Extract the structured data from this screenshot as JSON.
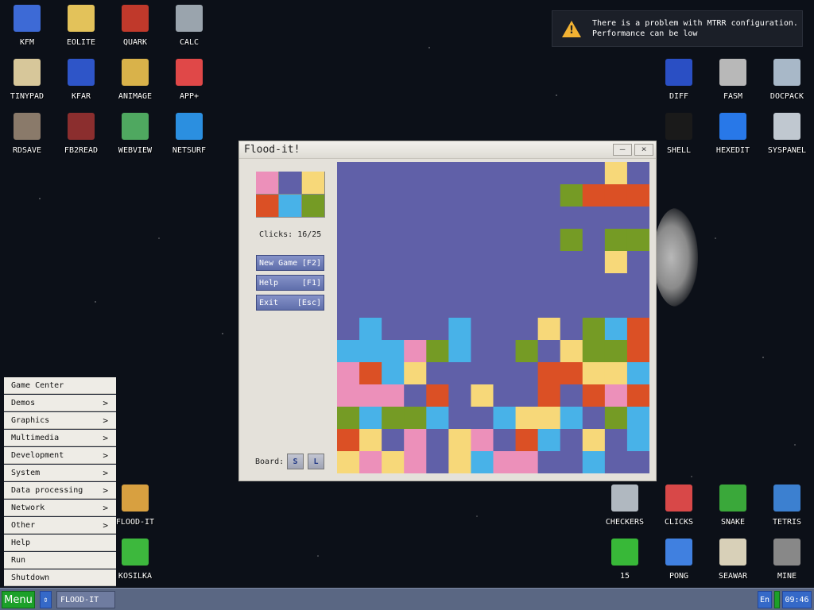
{
  "desktop_icons": [
    {
      "label": "KFM",
      "icon": "floppy-disk-icon",
      "color": "#3d6ad6"
    },
    {
      "label": "EOLITE",
      "icon": "folder-icon",
      "color": "#e3c25a"
    },
    {
      "label": "QUARK",
      "icon": "notebook-icon",
      "color": "#c0392b"
    },
    {
      "label": "CALC",
      "icon": "calculator-icon",
      "color": "#9aa4ad"
    },
    {
      "label": "TINYPAD",
      "icon": "notepad-icon",
      "color": "#d7c79a"
    },
    {
      "label": "KFAR",
      "icon": "kfar-icon",
      "color": "#2e55c8"
    },
    {
      "label": "ANIMAGE",
      "icon": "pencil-ruler-icon",
      "color": "#d9b24a"
    },
    {
      "label": "APP+",
      "icon": "rubiks-cube-icon",
      "color": "#e04848"
    },
    {
      "label": "RDSAVE",
      "icon": "ramdisk-icon",
      "color": "#8a7a6a"
    },
    {
      "label": "FB2READ",
      "icon": "book-icon",
      "color": "#8b2e2e"
    },
    {
      "label": "WEBVIEW",
      "icon": "browser-icon",
      "color": "#4fa860"
    },
    {
      "label": "NETSURF",
      "icon": "globe-icon",
      "color": "#2b8fe0"
    },
    {
      "label": "DIFF",
      "icon": "diff-icon",
      "color": "#2a4fc4"
    },
    {
      "label": "FASM",
      "icon": "fasm-icon",
      "color": "#b8b8b8"
    },
    {
      "label": "DOCPACK",
      "icon": "cabinet-icon",
      "color": "#a8b8c8"
    },
    {
      "label": "SHELL",
      "icon": "terminal-icon",
      "color": "#1a1a1a"
    },
    {
      "label": "HEXEDIT",
      "icon": "hex-editor-icon",
      "color": "#2878e8"
    },
    {
      "label": "SYSPANEL",
      "icon": "sliders-icon",
      "color": "#c0c8d0"
    },
    {
      "label": "FLOOD-IT",
      "icon": "flood-it-icon",
      "color": "#d8a040"
    },
    {
      "label": "KOSILKA",
      "icon": "lawnmower-icon",
      "color": "#3db83d"
    },
    {
      "label": "CHECKERS",
      "icon": "checkers-icon",
      "color": "#b0b8c0"
    },
    {
      "label": "CLICKS",
      "icon": "clicks-icon",
      "color": "#d84848"
    },
    {
      "label": "SNAKE",
      "icon": "snake-icon",
      "color": "#3aa83a"
    },
    {
      "label": "TETRIS",
      "icon": "tetris-icon",
      "color": "#3c80d0"
    },
    {
      "label": "15",
      "icon": "fifteen-puzzle-icon",
      "color": "#38b838"
    },
    {
      "label": "PONG",
      "icon": "pong-icon",
      "color": "#4080e0"
    },
    {
      "label": "SEAWAR",
      "icon": "sailing-ship-icon",
      "color": "#d8d0b8"
    },
    {
      "label": "MINE",
      "icon": "mine-icon",
      "color": "#888888"
    }
  ],
  "notification": {
    "icon": "warning-icon",
    "line1": "There is a problem with MTRR configuration.",
    "line2": "Performance can be low"
  },
  "window": {
    "title": "Flood-it!",
    "minimize": "–",
    "close": "×",
    "clicks_label": "Clicks:",
    "clicks_value": "16/25",
    "buttons": [
      {
        "label": "New Game",
        "key": "[F2]"
      },
      {
        "label": "Help",
        "key": "[F1]"
      },
      {
        "label": "Exit",
        "key": "[Esc]"
      }
    ],
    "board_label": "Board:",
    "size_small": "S",
    "size_large": "L",
    "palette_colors": [
      "pink",
      "purple",
      "yellow",
      "orange",
      "cyan",
      "green"
    ],
    "color_map": {
      "P": "#6060a8",
      "Y": "#f7d879",
      "O": "#db5025",
      "G": "#759b25",
      "C": "#48b2e8",
      "K": "#ec90ba"
    }
  },
  "board": {
    "rows": [
      "PPPPPPPPPPPPYP",
      "PPPPPPPPPPGOOO",
      "PPPPPPPPPPPPPP",
      "PPPPPPPPPPGPGG",
      "PPPPPPPPPPPPYP",
      "PPPPPPPPPPPPPP",
      "PPPPPPPPPPPPPP",
      "PCPPPCPPPYPGCO",
      "CCCKGCPPGPYGGO",
      "KOCYPPPPPOOYYC",
      "KKKPOPYPPOPOKO",
      "GCGGCPPCYYCPGC",
      "OYPKPYKPOCPYPC",
      "YKYKPYCKKPPCPP"
    ]
  },
  "start_menu": {
    "items": [
      {
        "label": "Game Center",
        "submenu": false
      },
      {
        "label": "Demos",
        "submenu": true
      },
      {
        "label": "Graphics",
        "submenu": true
      },
      {
        "label": "Multimedia",
        "submenu": true
      },
      {
        "label": "Development",
        "submenu": true
      },
      {
        "label": "System",
        "submenu": true
      },
      {
        "label": "Data processing",
        "submenu": true
      },
      {
        "label": "Network",
        "submenu": true
      },
      {
        "label": "Other",
        "submenu": true
      },
      {
        "label": "Help",
        "submenu": false
      },
      {
        "label": "Run",
        "submenu": false
      },
      {
        "label": "Shutdown",
        "submenu": false
      }
    ],
    "arrow": ">"
  },
  "taskbar": {
    "menu_label": "Menu",
    "updown_glyph": "⇕",
    "task_label": "FLOOD-IT",
    "lang": "En",
    "clock": "09:46"
  }
}
